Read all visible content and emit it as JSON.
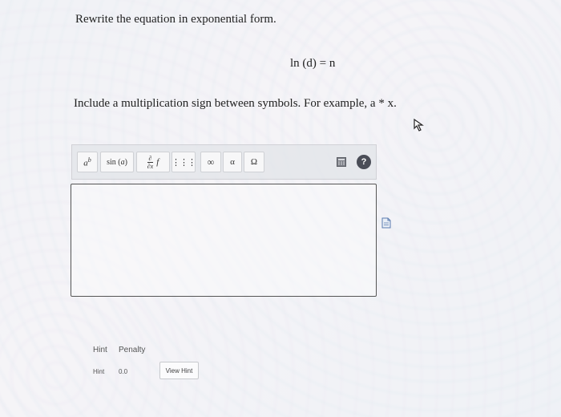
{
  "question": {
    "prompt": "Rewrite the equation in exponential form.",
    "equation": "ln (d) = n",
    "instruction": "Include a multiplication sign between symbols. For example, a * x."
  },
  "toolbar": {
    "buttons": [
      {
        "label": "a^b",
        "icon": "superscript-icon"
      },
      {
        "label": "sin (a)",
        "icon": "trig-function-icon"
      },
      {
        "label": "∂/∂x f",
        "icon": "partial-derivative-icon"
      },
      {
        "label": "⋮⋮⋮",
        "icon": "matrix-icon"
      },
      {
        "label": "∞",
        "icon": "infinity-icon"
      },
      {
        "label": "α",
        "icon": "greek-alpha-icon"
      },
      {
        "label": "Ω",
        "icon": "greek-omega-icon"
      },
      {
        "label": "",
        "icon": "keyboard-icon"
      },
      {
        "label": "?",
        "icon": "help-icon"
      }
    ]
  },
  "answer": {
    "value": ""
  },
  "hint": {
    "col_hint": "Hint",
    "col_penalty": "Penalty",
    "row_hint": "Hint",
    "row_penalty": "0.0",
    "view_label": "View Hint"
  },
  "colors": {
    "border": "#555555",
    "help": "#4a4d57"
  }
}
